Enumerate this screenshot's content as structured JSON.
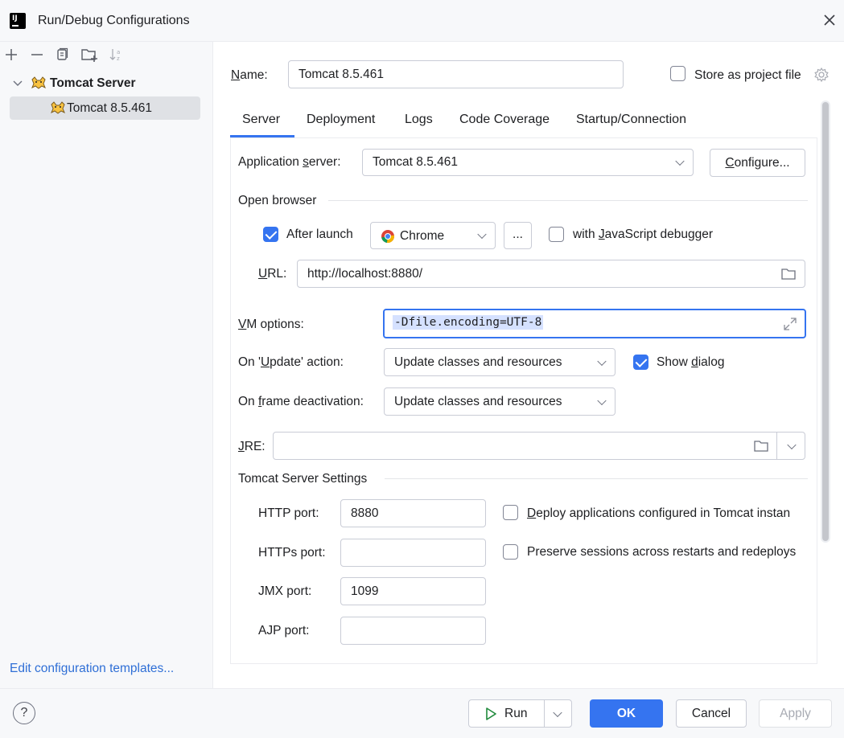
{
  "window": {
    "title": "Run/Debug Configurations"
  },
  "toolbar": {
    "icons": [
      "add-icon",
      "remove-icon",
      "copy-icon",
      "new-folder-icon",
      "sort-icon"
    ]
  },
  "tree": {
    "group_label": "Tomcat Server",
    "item_label": "Tomcat 8.5.461"
  },
  "left_footer": {
    "templates_link": "Edit configuration templates..."
  },
  "name_row": {
    "label": "Name:",
    "value": "Tomcat 8.5.461",
    "store_label": "Store as project file"
  },
  "tabs": [
    "Server",
    "Deployment",
    "Logs",
    "Code Coverage",
    "Startup/Connection"
  ],
  "server": {
    "app_server_label": "Application server:",
    "app_server_value": "Tomcat 8.5.461",
    "configure_label": "Configure...",
    "open_browser_label": "Open browser",
    "after_launch_label": "After launch",
    "browser_value": "Chrome",
    "more_label": "...",
    "js_debugger_label": "with JavaScript debugger",
    "url_label": "URL:",
    "url_value": "http://localhost:8880/",
    "vm_label": "VM options:",
    "vm_value": "-Dfile.encoding=UTF-8",
    "update_label": "On 'Update' action:",
    "update_value": "Update classes and resources",
    "show_dialog_label": "Show dialog",
    "frame_label": "On frame deactivation:",
    "frame_value": "Update classes and resources",
    "jre_label": "JRE:",
    "jre_value": "",
    "tomcat_settings_label": "Tomcat Server Settings",
    "http_label": "HTTP port:",
    "http_value": "8880",
    "https_label": "HTTPs port:",
    "https_value": "",
    "jmx_label": "JMX port:",
    "jmx_value": "1099",
    "ajp_label": "AJP port:",
    "ajp_value": "",
    "deploy_label": "Deploy applications configured in Tomcat instan",
    "preserve_label": "Preserve sessions across restarts and redeploys"
  },
  "checkboxes": {
    "store_project": false,
    "after_launch": true,
    "js_debugger": false,
    "show_dialog": true,
    "deploy": false,
    "preserve": false
  },
  "buttons": {
    "help": "?",
    "run": "Run",
    "ok": "OK",
    "cancel": "Cancel",
    "apply": "Apply"
  },
  "colors": {
    "accent": "#3574f0",
    "link": "#2f6fd6",
    "selection": "#dfe1e5",
    "panel": "#f7f8fa"
  }
}
